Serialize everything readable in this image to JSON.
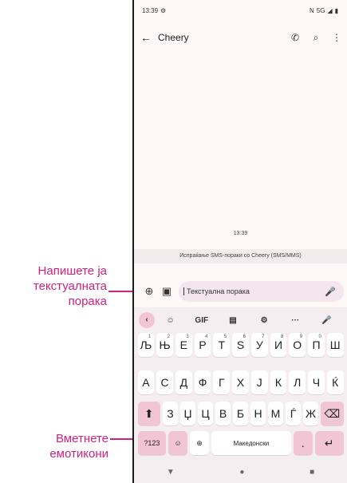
{
  "callouts": [
    {
      "name": "type-message-callout",
      "lines": [
        "Напишете ја",
        "текстуалната",
        "порака"
      ]
    },
    {
      "name": "insert-emoji-callout",
      "lines": [
        "Вметнете",
        "емотикони"
      ]
    }
  ],
  "status": {
    "time": "13:39",
    "settings_icon": "⚙",
    "network": "5G",
    "signal_icon": "◢",
    "battery_icon": "▮",
    "nfc_icon": "N"
  },
  "appbar": {
    "back_icon": "←",
    "title": "Cheery",
    "call_icon": "✆",
    "search_icon": "⌕",
    "menu_icon": "⋮"
  },
  "conversation": {
    "timestamp": "13:39",
    "sending_note": "Испраќање SMS-пораки со Cheery (SMS/MMS)"
  },
  "composer": {
    "add_icon": "⊕",
    "gallery_icon": "▣",
    "placeholder": "Текстуална порака",
    "mic_icon": "🎤"
  },
  "keyboard": {
    "toolbar": [
      {
        "name": "toolbar-back",
        "label": "‹"
      },
      {
        "name": "sticker-icon",
        "label": "☺"
      },
      {
        "name": "gif-button",
        "label": "GIF"
      },
      {
        "name": "clipboard-icon",
        "label": "▤"
      },
      {
        "name": "settings-icon",
        "label": "⚙"
      },
      {
        "name": "more-icon",
        "label": "···"
      },
      {
        "name": "voice-icon",
        "label": "🎤"
      }
    ],
    "row1": [
      {
        "k": "Љ",
        "h": "1"
      },
      {
        "k": "Њ",
        "h": "2"
      },
      {
        "k": "Е",
        "h": "3"
      },
      {
        "k": "Р",
        "h": "4"
      },
      {
        "k": "Т",
        "h": "5"
      },
      {
        "k": "Ѕ",
        "h": "6"
      },
      {
        "k": "У",
        "h": "7"
      },
      {
        "k": "И",
        "h": "8"
      },
      {
        "k": "О",
        "h": "9"
      },
      {
        "k": "П",
        "h": "0"
      },
      {
        "k": "Ш",
        "h": ""
      }
    ],
    "row2": [
      "А",
      "С",
      "Д",
      "Ф",
      "Г",
      "Х",
      "Ј",
      "К",
      "Л",
      "Ч",
      "Ќ"
    ],
    "row3": [
      "З",
      "Џ",
      "Ц",
      "В",
      "Б",
      "Н",
      "М",
      "Ѓ",
      "Ж"
    ],
    "shift_icon": "⬆",
    "backspace_icon": "⌫",
    "symbols_label": "?123",
    "emoji_icon": "☺",
    "globe_icon": "⊕",
    "space_label": "Македонски",
    "period_label": ".",
    "enter_icon": "↵"
  },
  "navbar": {
    "back_icon": "▼",
    "home_icon": "●",
    "recents_icon": "■"
  }
}
